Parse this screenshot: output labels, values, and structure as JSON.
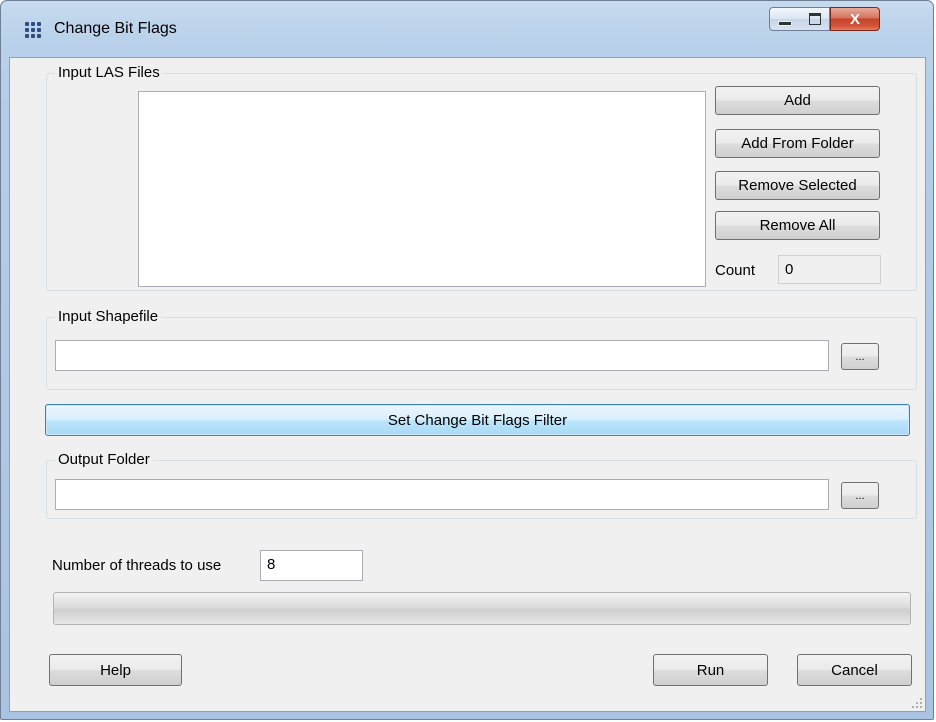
{
  "window": {
    "title": "Change Bit Flags",
    "icon": "grid-app-icon",
    "controls": {
      "minimize": "minimize-icon",
      "maximize": "maximize-icon",
      "close": "X"
    }
  },
  "input_las": {
    "legend": "Input LAS Files",
    "files": [],
    "buttons": {
      "add": "Add",
      "add_from_folder": "Add From Folder",
      "remove_selected": "Remove Selected",
      "remove_all": "Remove All"
    },
    "count_label": "Count",
    "count_value": "0"
  },
  "input_shapefile": {
    "legend": "Input Shapefile",
    "value": "",
    "browse_label": "..."
  },
  "filter_button": "Set Change Bit Flags Filter",
  "output_folder": {
    "legend": "Output Folder",
    "value": "",
    "browse_label": "..."
  },
  "threads": {
    "label": "Number of threads to use",
    "value": "8"
  },
  "progress": {
    "fraction": 0
  },
  "footer": {
    "help": "Help",
    "run": "Run",
    "cancel": "Cancel"
  }
}
